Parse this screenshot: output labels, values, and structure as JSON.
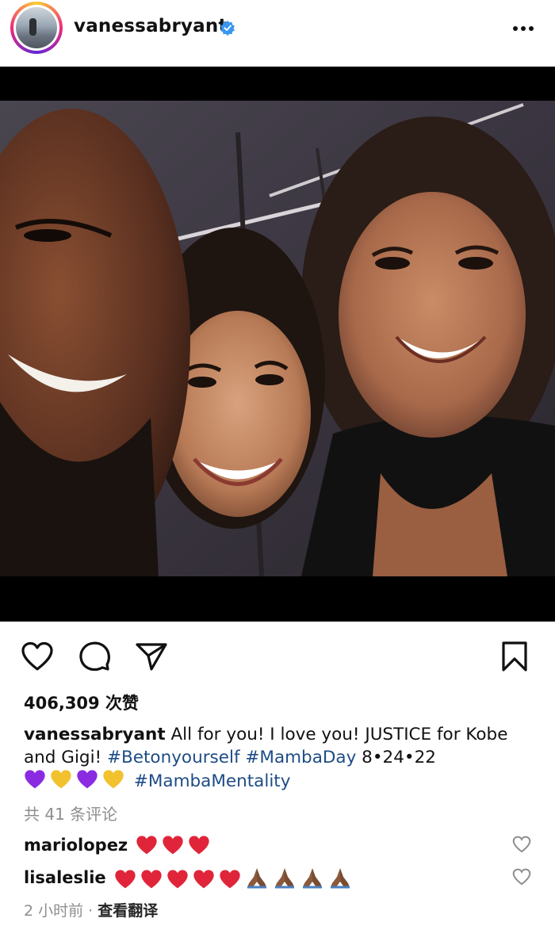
{
  "post": {
    "username": "vanessabryant",
    "verified_icon": "verified-badge-icon",
    "more_icon": "more-dots-icon",
    "likes": "406,309 次赞",
    "caption": {
      "username": "vanessabryant",
      "text1": " All for you! I love you! JUSTICE for Kobe and Gigi! ",
      "tag1": "#Betonyourself",
      "tag2": "#MambaDay",
      "date": " 8•24•22",
      "tag3": "#MambaMentality",
      "emoji_colors": [
        "#8a2be2",
        "#f2c12e",
        "#8a2be2",
        "#f2c12e"
      ]
    },
    "comments_count": "共 41 条评论",
    "comments": [
      {
        "username": "mariolopez",
        "hearts": 3,
        "praying": 0
      },
      {
        "username": "lisaleslie",
        "hearts": 5,
        "praying": 4
      }
    ],
    "time": "2 小时前",
    "separator": " · ",
    "translate": "查看翻译",
    "colors": {
      "hashtag": "#1e4c86",
      "verified": "#3897f0",
      "heart": "#e0253a"
    }
  }
}
